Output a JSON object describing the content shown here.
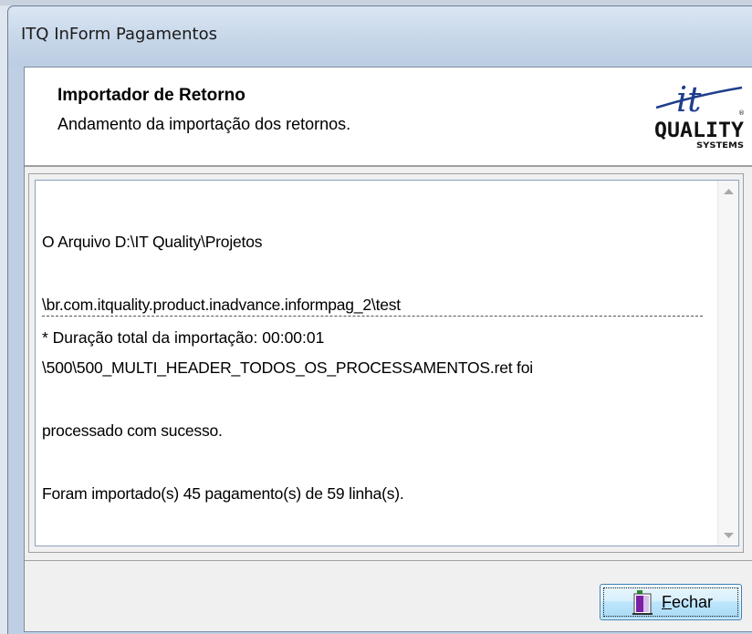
{
  "window": {
    "title": "ITQ InForm Pagamentos"
  },
  "header": {
    "title": "Importador de Retorno",
    "subtitle": "Andamento da importação dos retornos.",
    "logo": {
      "top": "it",
      "main": "QUALITY",
      "sub": "SYSTEMS",
      "registered": "®"
    }
  },
  "log": {
    "lines": [
      "O Arquivo D:\\IT Quality\\Projetos",
      "\\br.com.itquality.product.inadvance.informpag_2\\test",
      "\\500\\500_MULTI_HEADER_TODOS_OS_PROCESSAMENTOS.ret foi",
      "processado com sucesso.",
      "Foram importado(s) 45 pagamento(s) de 59 linha(s)."
    ],
    "summary": "* Duração total da importação: 00:00:01"
  },
  "buttons": {
    "close_accel": "F",
    "close_rest": "echar",
    "close_icon": "door-exit-icon"
  },
  "colors": {
    "titlebar": "#c8d8ea",
    "button_accent": "#3c7fb1",
    "memo_border": "#8aa1bd"
  }
}
